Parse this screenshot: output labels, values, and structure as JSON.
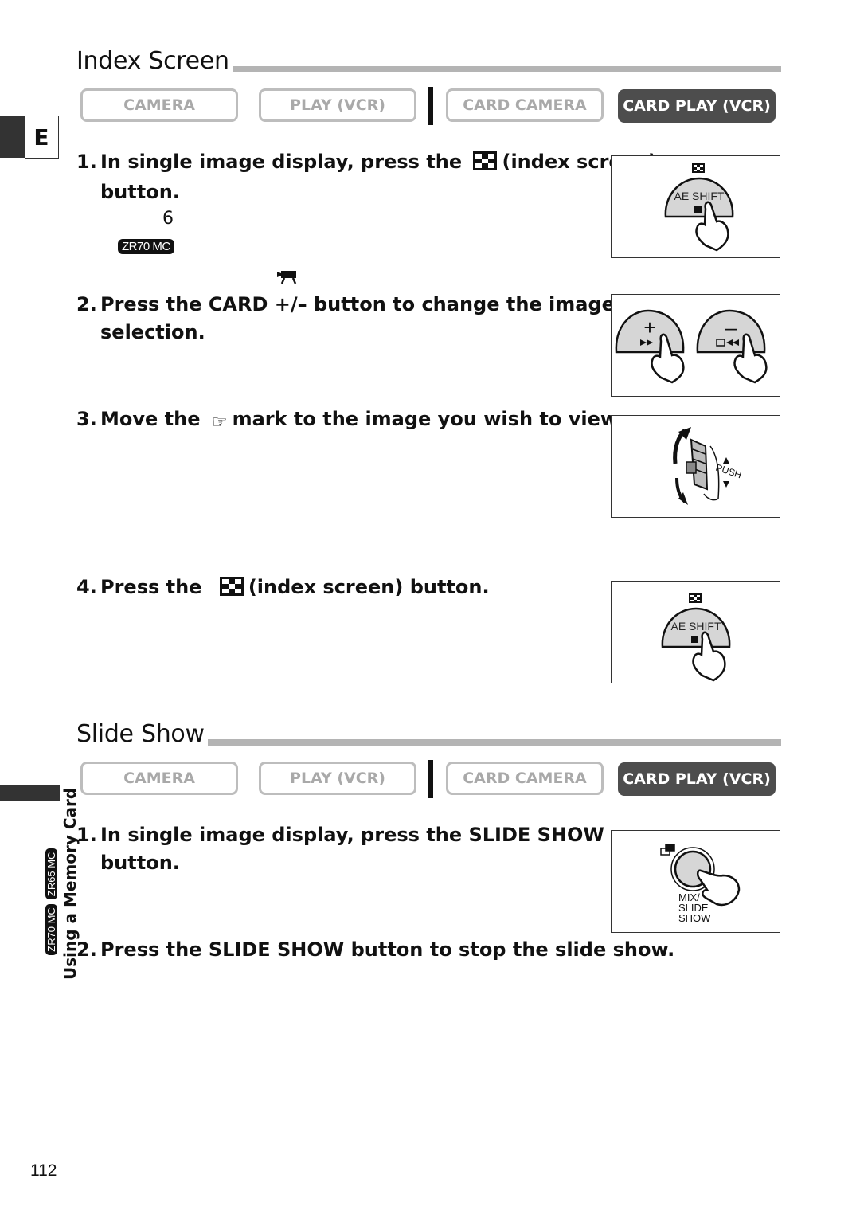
{
  "language_tab": "E",
  "mode_labels": {
    "camera": "CAMERA",
    "play_vcr": "PLAY (VCR)",
    "card_camera": "CARD CAMERA",
    "card_play_vcr": "CARD PLAY (VCR)",
    "active": "CARD PLAY (VCR)"
  },
  "colors": {
    "active_mode_bg": "#4d4d4d",
    "inactive_mode_text": "#a9a9a9",
    "rule": "#b4b4b4"
  },
  "index_screen": {
    "title": "Index Screen",
    "steps": [
      {
        "num": "1.",
        "pre": "In single image display, press the",
        "icon": "index-screen-icon",
        "post": "(index screen)",
        "cont": "button."
      },
      {
        "num": "2.",
        "text": "Press the CARD +/– button to change the image",
        "cont": "selection."
      },
      {
        "num": "3.",
        "pre": "Move the",
        "icon": "pointing-hand-icon",
        "post": "mark to the image you wish to view."
      },
      {
        "num": "4.",
        "pre": "Press the",
        "icon": "index-screen-icon",
        "post": "(index screen) button."
      }
    ],
    "note_number": "6",
    "note_model_badge": "ZR70 MC",
    "illustrations": [
      {
        "label": "AE SHIFT"
      },
      {
        "plus": "+",
        "minus": "–"
      },
      {
        "label": "PUSH"
      },
      {
        "label": "AE SHIFT"
      }
    ]
  },
  "slide_show": {
    "title": "Slide Show",
    "steps": [
      {
        "num": "1.",
        "text": "In single image display, press the SLIDE SHOW",
        "cont": "button."
      },
      {
        "num": "2.",
        "text": "Press the SLIDE SHOW button to stop the slide show."
      }
    ],
    "illustration": {
      "line1": "MIX/",
      "line2": "SLIDE",
      "line3": "SHOW"
    }
  },
  "sidebar": {
    "section": "Using a Memory Card",
    "badges": [
      "ZR70 MC",
      "ZR65 MC"
    ]
  },
  "page_number": "112"
}
